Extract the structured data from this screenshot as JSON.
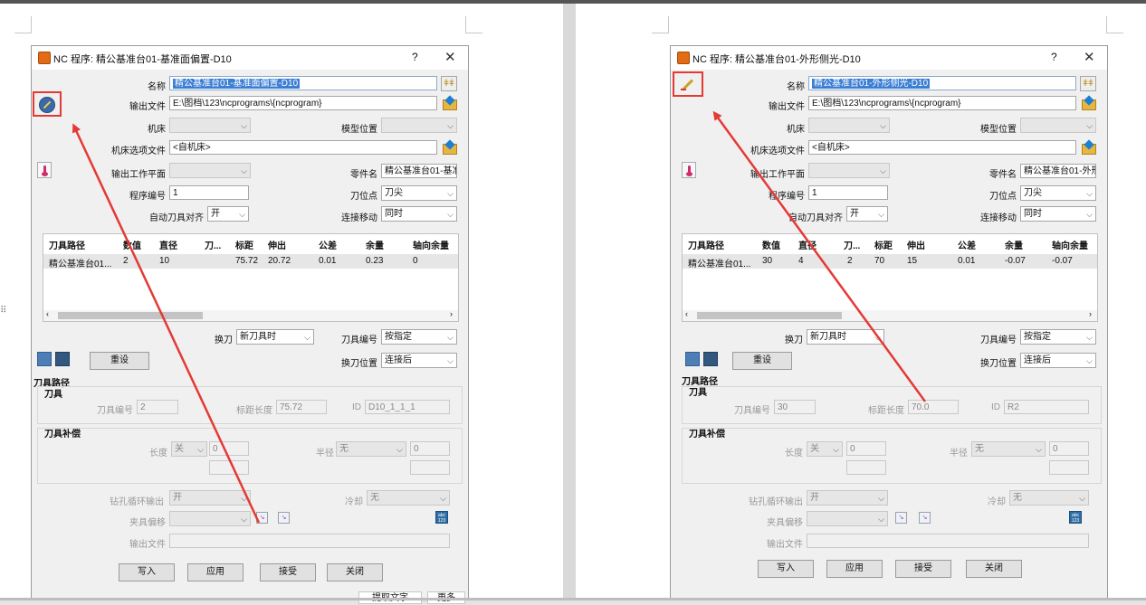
{
  "left": {
    "dialog_title": "NC 程序:  精公基准台01-基准面偏置-D10",
    "name_value": "精公基准台01-基准面偏置-D10",
    "tool_row": {
      "path": "精公基准台01...",
      "num": "2",
      "dia": "10",
      "len": "",
      "gauge": "75.72",
      "ext": "20.72",
      "tol": "0.01",
      "allow": "0.23",
      "axial": "0"
    },
    "tool_number": "2",
    "gauge_length": "75.72",
    "tool_id": "D10_1_1_1"
  },
  "right": {
    "dialog_title": "NC 程序:  精公基准台01-外形侧光-D10",
    "name_value": "精公基准台01-外形侧光-D10",
    "tool_row": {
      "path": "精公基准台01...",
      "num": "30",
      "dia": "4",
      "len": "2",
      "gauge": "70",
      "ext": "15",
      "tol": "0.01",
      "allow": "-0.07",
      "axial": "-0.07"
    },
    "tool_number": "30",
    "gauge_length": "70.0",
    "tool_id": "R2"
  },
  "labels": {
    "help": "?",
    "close": "✕",
    "name": "名称",
    "output_file": "输出文件",
    "output_file_value": "E:\\图档\\123\\ncprograms\\{ncprogram}",
    "machine": "机床",
    "model_position": "模型位置",
    "machine_option_file": "机床选项文件",
    "machine_option_value": "<自机床>",
    "output_workplane": "输出工作平面",
    "part_name": "零件名",
    "part_name_value": "精公基准台01-基准",
    "part_name_value_right": "精公基准台01-外形",
    "program_number": "程序编号",
    "program_number_value": "1",
    "tool_tip": "刀位点",
    "tool_tip_value": "刀尖",
    "auto_tool_align": "自动刀具对齐",
    "auto_tool_align_value": "开",
    "link_move": "连接移动",
    "link_move_value": "同时",
    "col_path": "刀具路径",
    "col_num": "数值",
    "col_dia": "直径",
    "col_len": "刀...",
    "col_gauge": "标距",
    "col_ext": "伸出",
    "col_tol": "公差",
    "col_allow": "余量",
    "col_axial": "轴向余量",
    "tool_change": "换刀",
    "tool_change_value": "新刀具时",
    "tool_number_label": "刀具编号",
    "tool_number_mode": "按指定",
    "tool_change_position": "换刀位置",
    "tool_change_position_value": "连接后",
    "reset": "重设",
    "toolpath_section": "刀具路径",
    "tool_section": "刀具",
    "tool_number_field": "刀具编号",
    "gauge_length_field": "标距长度",
    "id_field": "ID",
    "tool_comp_section": "刀具补偿",
    "length": "长度",
    "length_value": "关",
    "length_num": "0",
    "radius": "半径",
    "radius_value": "无",
    "radius_num": "0",
    "drill_cycle_output": "钻孔循环输出",
    "drill_cycle_value": "开",
    "coolant": "冷却",
    "coolant_value": "无",
    "fixture_offset": "夹具偏移",
    "output_file2": "输出文件",
    "write": "写入",
    "apply": "应用",
    "accept": "接受",
    "close_btn": "关闭"
  },
  "doc_controls": {
    "extract_text": "提取文字",
    "more": "更多"
  },
  "colors": {
    "highlight_box": "#e53935",
    "arrow": "#e53935",
    "selection": "#3b7fd4"
  }
}
